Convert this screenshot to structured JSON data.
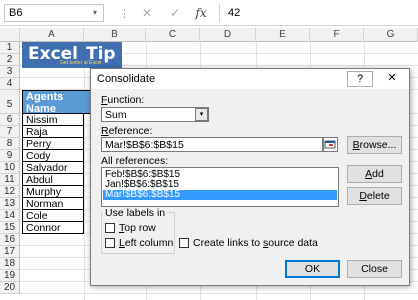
{
  "formula_bar": {
    "name_box": "B6",
    "name_box_arrow": "▾",
    "separator": "⋮",
    "cancel_icon": "✕",
    "enter_icon": "✓",
    "fx_label": "fx",
    "value": "42"
  },
  "columns": [
    "A",
    "B",
    "C",
    "D",
    "E",
    "F",
    "G"
  ],
  "rows": [
    "1",
    "2",
    "3",
    "4",
    "5",
    "6",
    "7",
    "8",
    "9",
    "10",
    "11",
    "12",
    "13",
    "14",
    "15",
    "16",
    "17",
    "18",
    "19",
    "20"
  ],
  "logo": {
    "word1": "Excel",
    "word2": "Tip",
    "tagline": "Get better at Excel"
  },
  "sheet": {
    "header_line1": "Agents",
    "header_line2": "Name",
    "agents": [
      "Nissim",
      "Raja",
      "Perry",
      "Cody",
      "Salvador",
      "Abdul",
      "Murphy",
      "Norman",
      "Cole",
      "Connor"
    ]
  },
  "dialog": {
    "title": "Consolidate",
    "help": "?",
    "close": "✕",
    "function_label_key": "F",
    "function_label_rest": "unction:",
    "function_value": "Sum",
    "function_arrow": "▾",
    "reference_label_key": "R",
    "reference_label_rest": "eference:",
    "reference_value": "Mar!$B$6:$B$15",
    "all_references_label": "All references:",
    "all_references": [
      "Feb!$B$6:$B$15",
      "Jan!$B$6:$B$15",
      "Mar!$B$6:$B$15"
    ],
    "selected_reference_index": 2,
    "browse_button_key": "B",
    "browse_button_rest": "rowse...",
    "add_button_key": "A",
    "add_button_rest": "dd",
    "delete_button_key": "D",
    "delete_button_rest": "elete",
    "use_labels_in": "Use labels in",
    "top_row_key": "T",
    "top_row_rest": "op row",
    "left_column_key": "L",
    "left_column_rest": "eft column",
    "create_links_pre": "Create links to ",
    "create_links_key": "s",
    "create_links_post": "ource data",
    "ok_button": "OK",
    "close_button": "Close"
  },
  "colors": {
    "selected_row": "#3399ff",
    "header_fill": "#5b9bd5",
    "logo_fill": "#3f6fb0"
  }
}
